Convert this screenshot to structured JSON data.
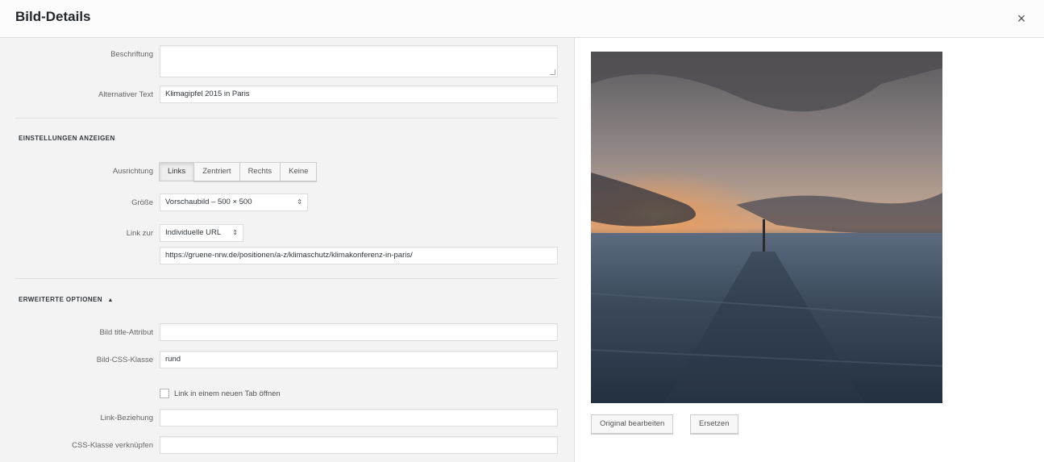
{
  "header": {
    "title": "Bild-Details",
    "close_symbol": "×"
  },
  "form": {
    "caption": {
      "label": "Beschriftung",
      "value": ""
    },
    "alt_text": {
      "label": "Alternativer Text",
      "value": "Klimagipfel 2015 in Paris"
    },
    "display_settings_heading": "EINSTELLUNGEN ANZEIGEN",
    "alignment": {
      "label": "Ausrichtung",
      "options": [
        "Links",
        "Zentriert",
        "Rechts",
        "Keine"
      ],
      "selected": "Links"
    },
    "size": {
      "label": "Größe",
      "value": "Vorschaubild – 500 × 500",
      "arrow": "⇕"
    },
    "link_to": {
      "label": "Link zur",
      "value": "Individuelle URL",
      "arrow": "⇕",
      "url": "https://gruene-nrw.de/positionen/a-z/klimaschutz/klimakonferenz-in-paris/"
    },
    "advanced_heading": "ERWEITERTE OPTIONEN",
    "advanced_toggle": "▲",
    "title_attr": {
      "label": "Bild title-Attribut",
      "value": ""
    },
    "css_class": {
      "label": "Bild-CSS-Klasse",
      "value": "rund"
    },
    "new_tab": {
      "label": "Link in einem neuen Tab öffnen",
      "checked": false
    },
    "link_rel": {
      "label": "Link-Beziehung",
      "value": ""
    },
    "link_css": {
      "label": "CSS-Klasse verknüpfen",
      "value": ""
    }
  },
  "preview": {
    "edit_original": "Original bearbeiten",
    "replace": "Ersetzen"
  }
}
